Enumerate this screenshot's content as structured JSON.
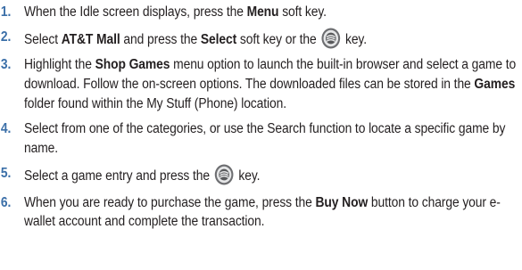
{
  "steps": [
    {
      "number": "1.",
      "t1": "When the Idle screen displays, press the ",
      "b1": "Menu",
      "t2": " soft key."
    },
    {
      "number": "2.",
      "t1": "Select ",
      "b1": "AT&T Mall",
      "t2": " and press the ",
      "b2": "Select",
      "t3": " soft key or the",
      "icon": "navigation-key-icon",
      "t4": "key."
    },
    {
      "number": "3.",
      "t1": "Highlight the ",
      "b1": "Shop Games",
      "t2": " menu option to launch the built-in browser and select a game to download. Follow the on-screen options. The downloaded files can be stored in the ",
      "b2": "Games",
      "t3": " folder found within the My Stuff (Phone) location."
    },
    {
      "number": "4.",
      "t1": "Select from one of the categories, or use the Search function to locate a specific game by name."
    },
    {
      "number": "5.",
      "t1": "Select a game entry and press the",
      "icon": "navigation-key-icon",
      "t2": "key."
    },
    {
      "number": "6.",
      "t1": "When you are ready to purchase the game, press the ",
      "b1": "Buy Now",
      "t2": " button to charge your e-wallet account and complete the transaction."
    }
  ],
  "colors": {
    "step_number": "#3b6fa8",
    "text": "#231f20",
    "icon_outer": "#6d6e71",
    "icon_inner": "#e6e7e8"
  }
}
